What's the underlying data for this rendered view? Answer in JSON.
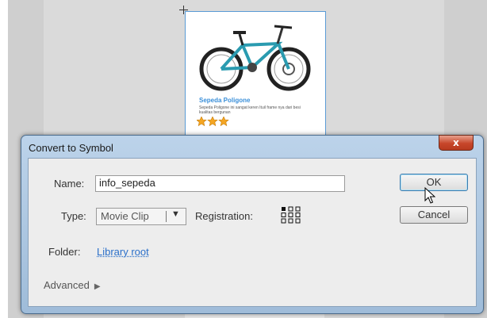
{
  "stage": {
    "product": {
      "title": "Sepeda Poligone",
      "description": "Sepeda Poligone ini sangat keren Ituil frame nya dari besi kualitas bergunan",
      "rating_stars": 3
    }
  },
  "dialog": {
    "title": "Convert to Symbol",
    "close_label": "x",
    "name_label": "Name:",
    "name_value": "info_sepeda",
    "type_label": "Type:",
    "type_value": "Movie Clip",
    "registration_label": "Registration:",
    "folder_label": "Folder:",
    "folder_value": "Library root",
    "advanced_label": "Advanced",
    "ok_label": "OK",
    "cancel_label": "Cancel"
  },
  "colors": {
    "link": "#2a6fc9",
    "close_button": "#c7462a",
    "product_title": "#3a8fd9",
    "star": "#f5a623"
  },
  "icons": [
    "crosshair-icon",
    "bicycle-image",
    "star-icon",
    "close-icon",
    "dropdown-arrow-icon",
    "registration-grid-icon",
    "disclosure-triangle-icon",
    "mouse-cursor-icon"
  ]
}
